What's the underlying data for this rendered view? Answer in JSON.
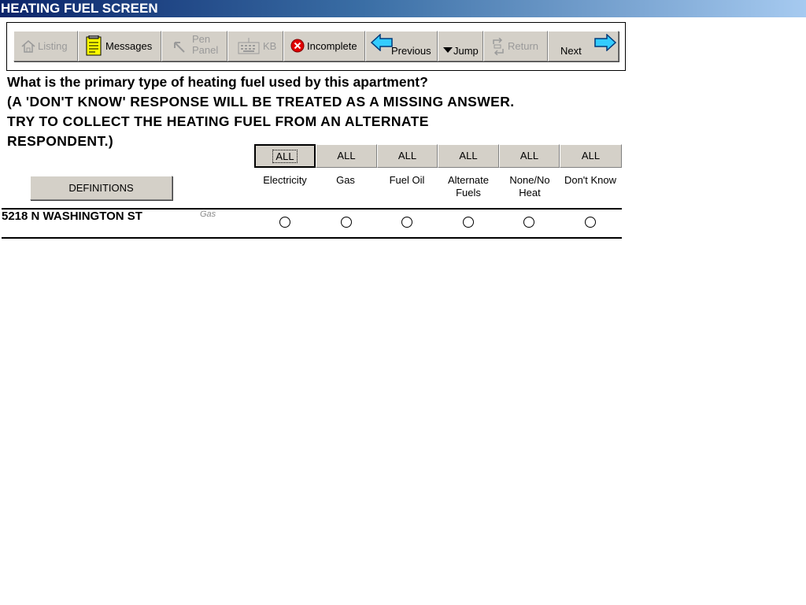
{
  "window": {
    "title": "HEATING FUEL SCREEN"
  },
  "toolbar": {
    "listing": "Listing",
    "messages": "Messages",
    "pen_panel_line1": "Pen",
    "pen_panel_line2": "Panel",
    "kb": "KB",
    "incomplete": "Incomplete",
    "previous": "Previous",
    "jump": "Jump",
    "return": "Return",
    "next": "Next"
  },
  "question": {
    "line1": "What is the primary type of heating fuel used by this apartment?",
    "line2": "(A 'DON'T KNOW' RESPONSE WILL BE TREATED AS A MISSING ANSWER.",
    "line3": "TRY TO COLLECT THE HEATING FUEL FROM AN ALTERNATE",
    "line4": "RESPONDENT.)"
  },
  "definitions_label": "DEFINITIONS",
  "options": [
    {
      "all_label": "ALL",
      "line1": "Electricity",
      "line2": ""
    },
    {
      "all_label": "ALL",
      "line1": "Gas",
      "line2": ""
    },
    {
      "all_label": "ALL",
      "line1": "Fuel Oil",
      "line2": ""
    },
    {
      "all_label": "ALL",
      "line1": "Alternate",
      "line2": "Fuels"
    },
    {
      "all_label": "ALL",
      "line1": "None/No",
      "line2": "Heat"
    },
    {
      "all_label": "ALL",
      "line1": "Don't Know",
      "line2": ""
    }
  ],
  "rows": [
    {
      "address": "5218 N WASHINGTON ST",
      "previous_answer": "Gas",
      "selected": null
    }
  ]
}
